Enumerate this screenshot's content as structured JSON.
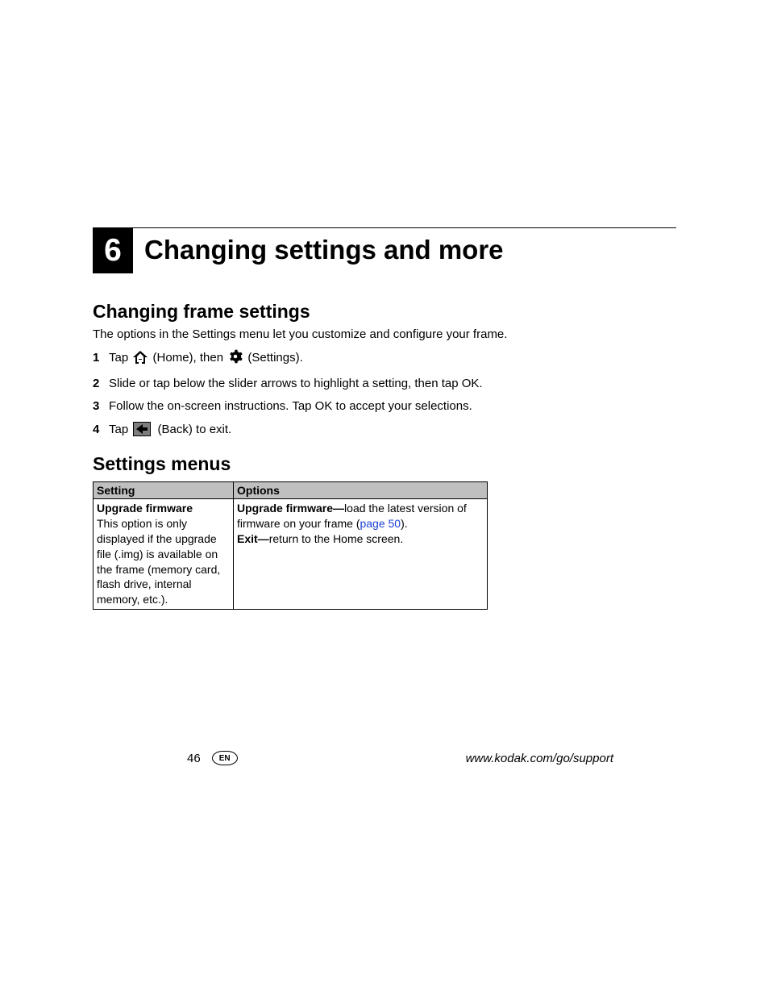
{
  "chapter": {
    "number": "6",
    "title": "Changing settings and more"
  },
  "section1": {
    "heading": "Changing frame settings",
    "intro": "The options in the Settings menu let you customize and configure your frame.",
    "steps": {
      "s1a": "Tap ",
      "s1b": " (Home), then ",
      "s1c": " (Settings).",
      "s2": "Slide or tap below the slider arrows to highlight a setting, then tap OK.",
      "s3": "Follow the on-screen instructions. Tap OK to accept your selections.",
      "s4a": "Tap ",
      "s4b": " (Back) to exit."
    }
  },
  "section2": {
    "heading": "Settings menus",
    "table": {
      "headers": {
        "c1": "Setting",
        "c2": "Options"
      },
      "row1": {
        "setting_title": "Upgrade firmware",
        "setting_desc": "This option is only displayed if the upgrade file (.img) is available on the frame (memory card, flash drive, internal memory, etc.).",
        "opt1_label": "Upgrade firmware—",
        "opt1_text": "load the latest version of firmware on your frame (",
        "opt1_link": "page 50",
        "opt1_after": ").",
        "opt2_label": "Exit—",
        "opt2_text": "return to the Home screen."
      }
    }
  },
  "footer": {
    "page": "46",
    "lang": "EN",
    "url": "www.kodak.com/go/support"
  }
}
